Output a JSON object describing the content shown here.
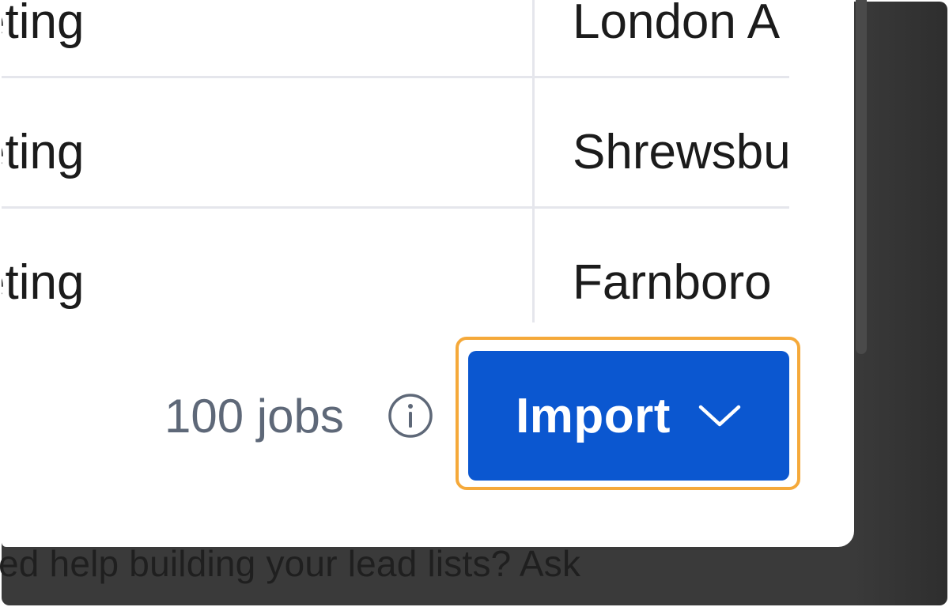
{
  "table": {
    "rows": [
      {
        "col_a": "eting",
        "col_b": "London A"
      },
      {
        "col_a": "eting",
        "col_b": "Shrewsbu"
      },
      {
        "col_a": "eting",
        "col_b": "Farnboro"
      }
    ]
  },
  "footer": {
    "jobs_count": "100 jobs",
    "info_icon": "info-circle-icon",
    "import_label": "Import",
    "import_icon": "chevron-down-icon"
  },
  "background": {
    "text": "ed help building your lead lists? Ask"
  },
  "colors": {
    "primary_button": "#0b57d0",
    "highlight_outline": "#f5a93a",
    "muted_text": "#5e6878",
    "overlay": "#3a3a3a"
  }
}
